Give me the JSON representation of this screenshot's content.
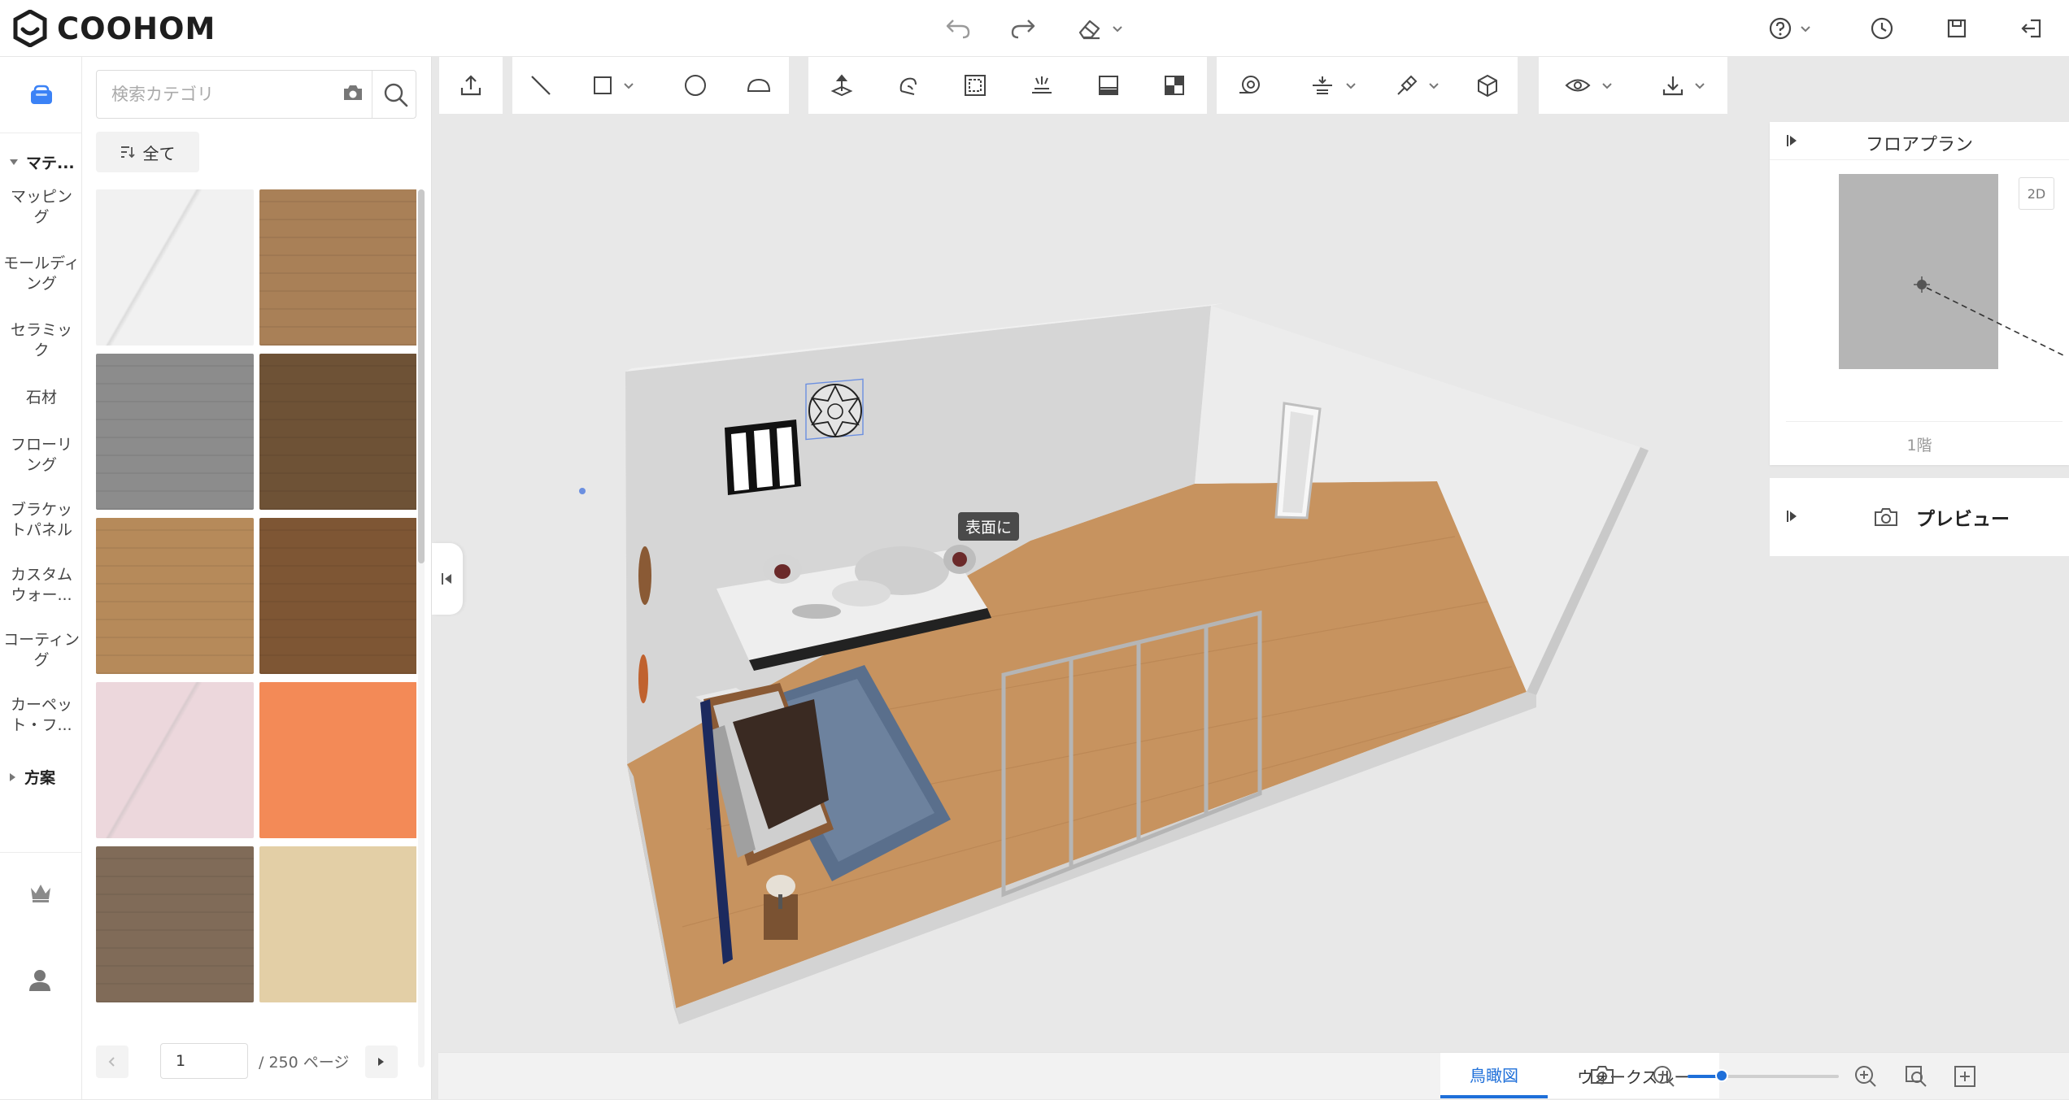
{
  "app": {
    "logo_text": "COOHOM"
  },
  "topbar": {
    "undo_icon": "undo-icon",
    "redo_icon": "redo-icon",
    "eraser_icon": "eraser-icon",
    "help_icon": "help-icon",
    "history_icon": "clock-icon",
    "save_icon": "save-icon",
    "exit_icon": "exit-icon"
  },
  "rail": {
    "groups": [
      {
        "label": "マテ..."
      },
      {
        "label": "方案"
      }
    ],
    "items": [
      {
        "label": "マッピング"
      },
      {
        "label": "モールディング"
      },
      {
        "label": "セラミック"
      },
      {
        "label": "石材"
      },
      {
        "label": "フローリング"
      },
      {
        "label": "ブラケットパネル"
      },
      {
        "label": "カスタムウォー..."
      },
      {
        "label": "コーティング"
      },
      {
        "label": "カーペット・フ..."
      }
    ]
  },
  "panel": {
    "search": {
      "placeholder": "検索カテゴリ"
    },
    "filter_label": "全て",
    "tiles": [
      {
        "name": "white-marble",
        "color": "#f1f1f1"
      },
      {
        "name": "oak-light",
        "color": "#a98057"
      },
      {
        "name": "grey-wood",
        "color": "#8c8c8c"
      },
      {
        "name": "dark-wood",
        "color": "#6e5236"
      },
      {
        "name": "honey-wood",
        "color": "#b68a5a"
      },
      {
        "name": "walnut-wood",
        "color": "#7e5634"
      },
      {
        "name": "pink-marble",
        "color": "#ecd7dc"
      },
      {
        "name": "orange-plaster",
        "color": "#f38a57"
      },
      {
        "name": "brown-planks",
        "color": "#806b58"
      },
      {
        "name": "sand-tile",
        "color": "#e3cfa6"
      }
    ],
    "pager": {
      "current": "1",
      "total": "/ 250 ページ"
    }
  },
  "floorplan": {
    "title": "フロアプラン",
    "view_toggle": "2D",
    "level": "1階"
  },
  "preview": {
    "label": "プレビュー"
  },
  "canvas": {
    "tooltip": "表面に"
  },
  "bottombar": {
    "tabs": [
      {
        "label": "鳥瞰図",
        "active": true
      },
      {
        "label": "ウォークスルー",
        "active": false
      }
    ],
    "zoom_level": 0.08
  },
  "colors": {
    "accent": "#1e6fd9",
    "logo_blue": "#3b82f6",
    "floor_wood": "#c7935f",
    "wall": "#dcdcdc",
    "canvas_bg": "#e8e8e8"
  }
}
